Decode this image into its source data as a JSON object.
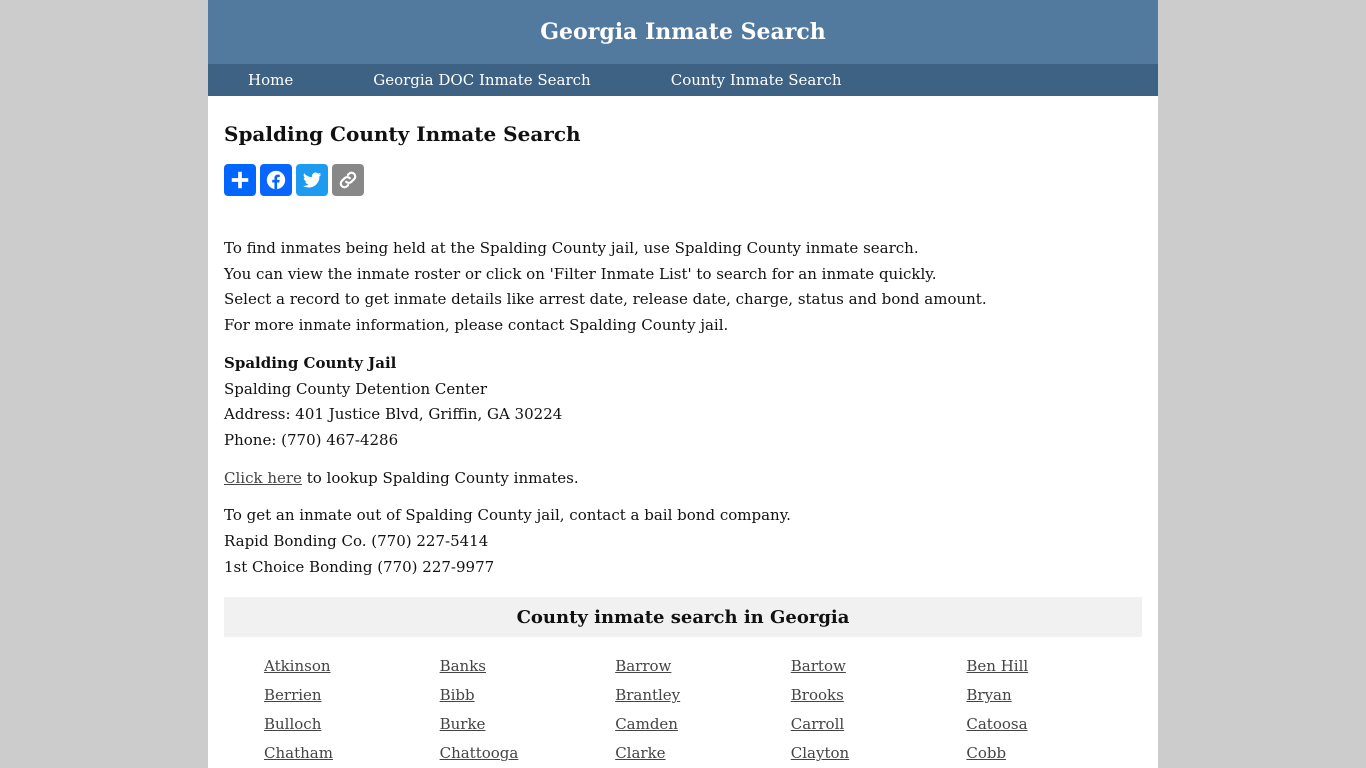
{
  "header": {
    "site_title": "Georgia Inmate Search"
  },
  "nav": {
    "items": [
      {
        "label": "Home"
      },
      {
        "label": "Georgia DOC Inmate Search"
      },
      {
        "label": "County Inmate Search"
      }
    ]
  },
  "main": {
    "page_title": "Spalding County Inmate Search",
    "share_buttons": [
      {
        "icon": "plus-icon",
        "label": "Share"
      },
      {
        "icon": "facebook-icon",
        "label": "Facebook"
      },
      {
        "icon": "twitter-icon",
        "label": "Twitter"
      },
      {
        "icon": "link-icon",
        "label": "Copy Link"
      }
    ],
    "intro": [
      "To find inmates being held at the Spalding County jail, use Spalding County inmate search.",
      "You can view the inmate roster or click on 'Filter Inmate List' to search for an inmate quickly.",
      "Select a record to get inmate details like arrest date, release date, charge, status and bond amount.",
      "For more inmate information, please contact Spalding County jail."
    ],
    "jail": {
      "name": "Spalding County Jail",
      "facility": "Spalding County Detention Center",
      "address": "Address: 401 Justice Blvd, Griffin, GA 30224",
      "phone": "Phone: (770) 467-4286"
    },
    "lookup": {
      "link_text": "Click here",
      "suffix": " to lookup Spalding County inmates."
    },
    "bail": [
      "To get an inmate out of Spalding County jail, contact a bail bond company.",
      "Rapid Bonding Co. (770) 227-5414",
      "1st Choice Bonding (770) 227-9977"
    ],
    "county_section": {
      "title": "County inmate search in Georgia",
      "counties": [
        "Atkinson",
        "Banks",
        "Barrow",
        "Bartow",
        "Ben Hill",
        "Berrien",
        "Bibb",
        "Brantley",
        "Brooks",
        "Bryan",
        "Bulloch",
        "Burke",
        "Camden",
        "Carroll",
        "Catoosa",
        "Chatham",
        "Chattooga",
        "Clarke",
        "Clayton",
        "Cobb"
      ]
    }
  }
}
